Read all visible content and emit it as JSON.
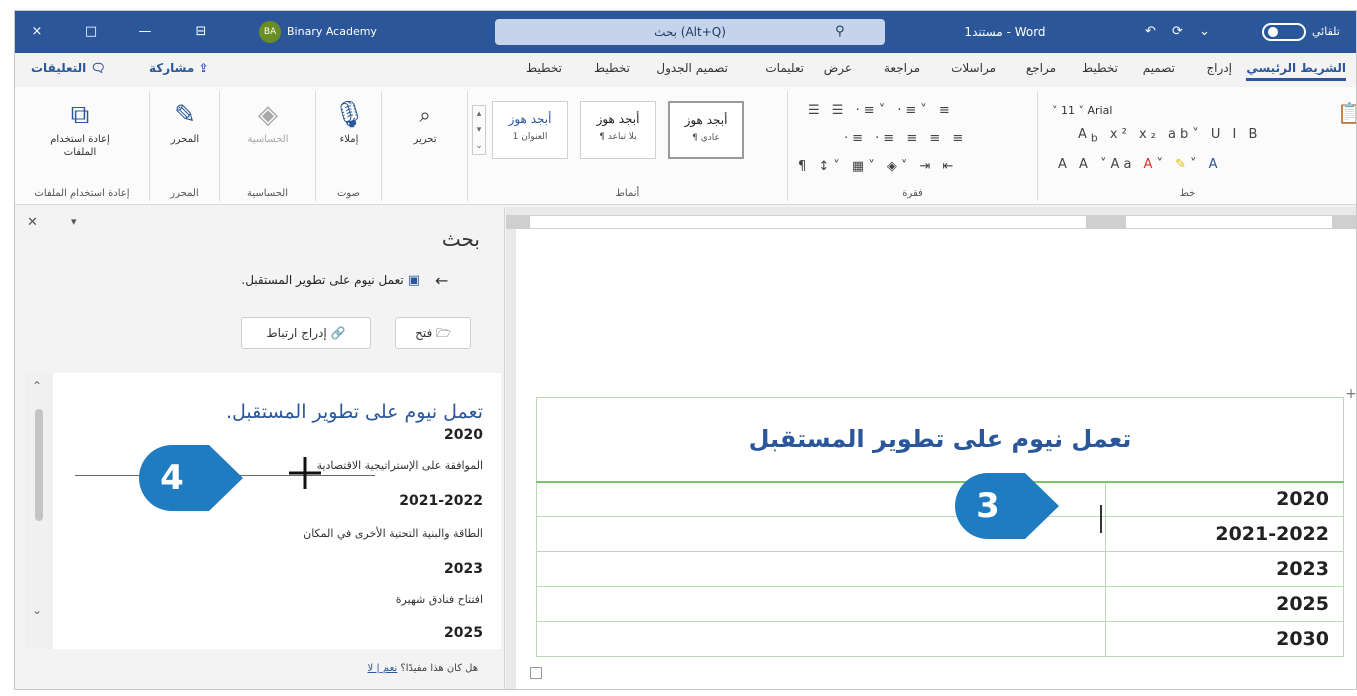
{
  "titlebar": {
    "window_close": "×",
    "window_restore": "□",
    "window_minimize": "—",
    "ribbon_display": "⊟",
    "account_initials": "BA",
    "account_name": "Binary Academy",
    "search_text": "بحث (Alt+Q)",
    "doc_title": "مستند1 - Word",
    "undo_group": "↶ ⟳ ⌄",
    "autosave_label": "تلقائي"
  },
  "tabs": {
    "home": "الشريط الرئيسي",
    "insert": "إدراج",
    "design": "تصميم",
    "layout": "تخطيط",
    "references": "مراجع",
    "mailings": "مراسلات",
    "review": "مراجعة",
    "view": "عرض",
    "help": "تعليمات",
    "table_design": "تصميم الجدول",
    "table_layout": "تخطيط",
    "draw": "تخطيط",
    "share": "مشاركة",
    "comments": "التعليقات"
  },
  "ribbon": {
    "reuse_files": "إعادة استخدام الملفات",
    "reuse_group": "إعادة استخدام الملفات",
    "editor": "المحرر",
    "editor_group": "المحرر",
    "sensitivity": "الحساسية",
    "sensitivity_group": "الحساسية",
    "dictate": "إملاء",
    "voice_group": "صوت",
    "find": "تحرير",
    "styles_group": "أنماط",
    "style_heading1": "أبجد هوز",
    "style_heading1_sub": "العنوان 1",
    "style_nospacing": "أبجد هوز",
    "style_nospacing_sub": "¶ بلا تباعد",
    "style_normal": "أبجد هوز",
    "style_normal_sub": "¶ عادي",
    "paragraph_group": "فقرة",
    "font_group": "خط",
    "font_name": "Arial",
    "font_size": "11"
  },
  "nav": {
    "title": "بحث",
    "result_doc": "تعمل نيوم على تطوير المستقبل.",
    "open_btn": "فتح",
    "insert_link_btn": "إدراج ارتباط",
    "preview_title": "تعمل نيوم على تطوير المستقبل.",
    "items": [
      {
        "year": "2020",
        "event": "الموافقة على الإستراتيجية الاقتصادية"
      },
      {
        "year": "2021-2022",
        "event": "الطاقة والبنية التحتية الأخرى في المكان"
      },
      {
        "year": "2023",
        "event": "افتتاح فنادق شهيرة"
      },
      {
        "year": "2025",
        "event": ""
      }
    ],
    "footer_text": "هل كان هذا مفيدًا؟",
    "footer_link": "نعم | لا"
  },
  "document": {
    "table_title": "تعمل نيوم على تطوير المستقبل",
    "rows": [
      "2020",
      "2021-2022",
      "2023",
      "2025",
      "2030"
    ]
  },
  "callouts": {
    "step3": "3",
    "step4": "4"
  },
  "colors": {
    "accent": "#2b579a",
    "callout": "#1f7cc0",
    "table_border": "#b9dcb3"
  }
}
